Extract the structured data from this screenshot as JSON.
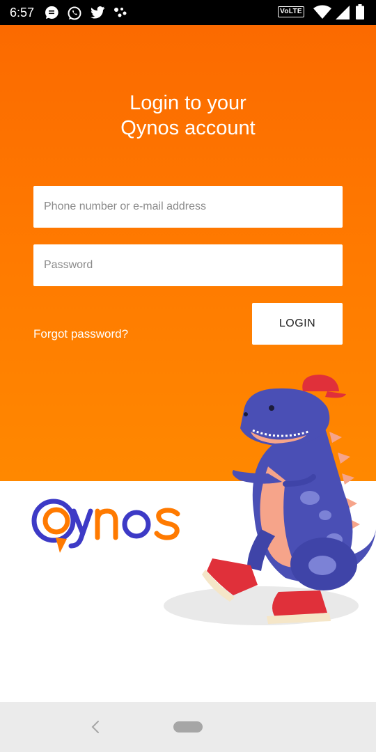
{
  "status_bar": {
    "time": "6:57",
    "left_icons": [
      "message-icon",
      "whatsapp-icon",
      "twitter-icon",
      "assistant-dots-icon"
    ],
    "right_icons": [
      "volte-badge",
      "wifi-icon",
      "signal-icon",
      "battery-icon"
    ],
    "volte_label": "VoLTE"
  },
  "login": {
    "title_line1": "Login to your",
    "title_line2": "Qynos account",
    "phone_placeholder": "Phone number or e-mail address",
    "password_placeholder": "Password",
    "login_label": "LOGIN",
    "forgot_label": "Forgot password?"
  },
  "brand": {
    "logo_text": "Qynos",
    "colors": {
      "orange": "#FF7A00",
      "purple": "#3D3AC6"
    }
  },
  "nav_bar": {
    "icons": [
      "back-icon",
      "home-pill-icon"
    ]
  }
}
